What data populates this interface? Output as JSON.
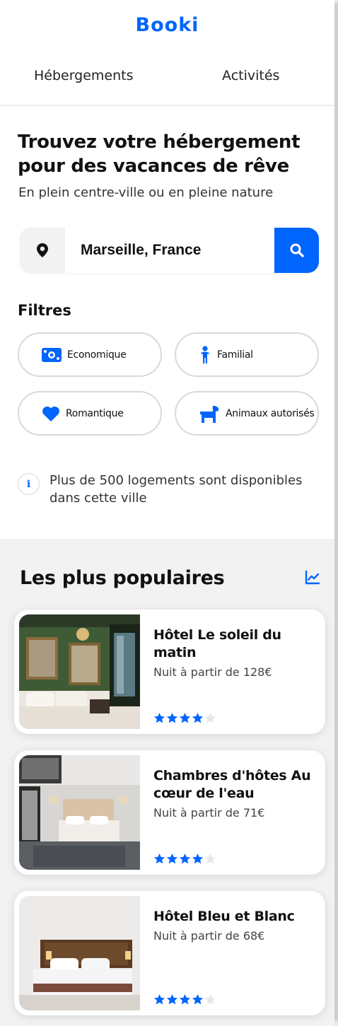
{
  "app": {
    "logo": "Booki",
    "brand_color": "#0065fc"
  },
  "nav": {
    "tabs": [
      {
        "label": "Hébergements"
      },
      {
        "label": "Activités"
      }
    ]
  },
  "hero": {
    "title": "Trouvez votre hébergement pour des vacances de rêve",
    "subtitle": "En plein centre-ville ou en pleine nature"
  },
  "search": {
    "value": "Marseille, France",
    "location_icon": "map-pin-icon",
    "button_icon": "search-icon"
  },
  "filters": {
    "title": "Filtres",
    "items": [
      {
        "label": "Economique",
        "icon": "money-bill-icon"
      },
      {
        "label": "Familial",
        "icon": "child-icon"
      },
      {
        "label": "Romantique",
        "icon": "heart-icon"
      },
      {
        "label": "Animaux autorisés",
        "icon": "dog-icon"
      }
    ]
  },
  "info": {
    "icon": "info-icon",
    "text": "Plus de 500 logements sont disponibles dans cette ville"
  },
  "popular": {
    "title": "Les plus populaires",
    "icon": "chart-line-icon",
    "items": [
      {
        "name": "Hôtel Le soleil du matin",
        "price": "Nuit à partir de 128€",
        "rating": 4,
        "max_rating": 5
      },
      {
        "name": "Chambres d'hôtes Au cœur de l'eau",
        "price": "Nuit à partir de 71€",
        "rating": 4,
        "max_rating": 5
      },
      {
        "name": "Hôtel Bleu et Blanc",
        "price": "Nuit à partir de 68€",
        "rating": 4,
        "max_rating": 5
      }
    ]
  }
}
